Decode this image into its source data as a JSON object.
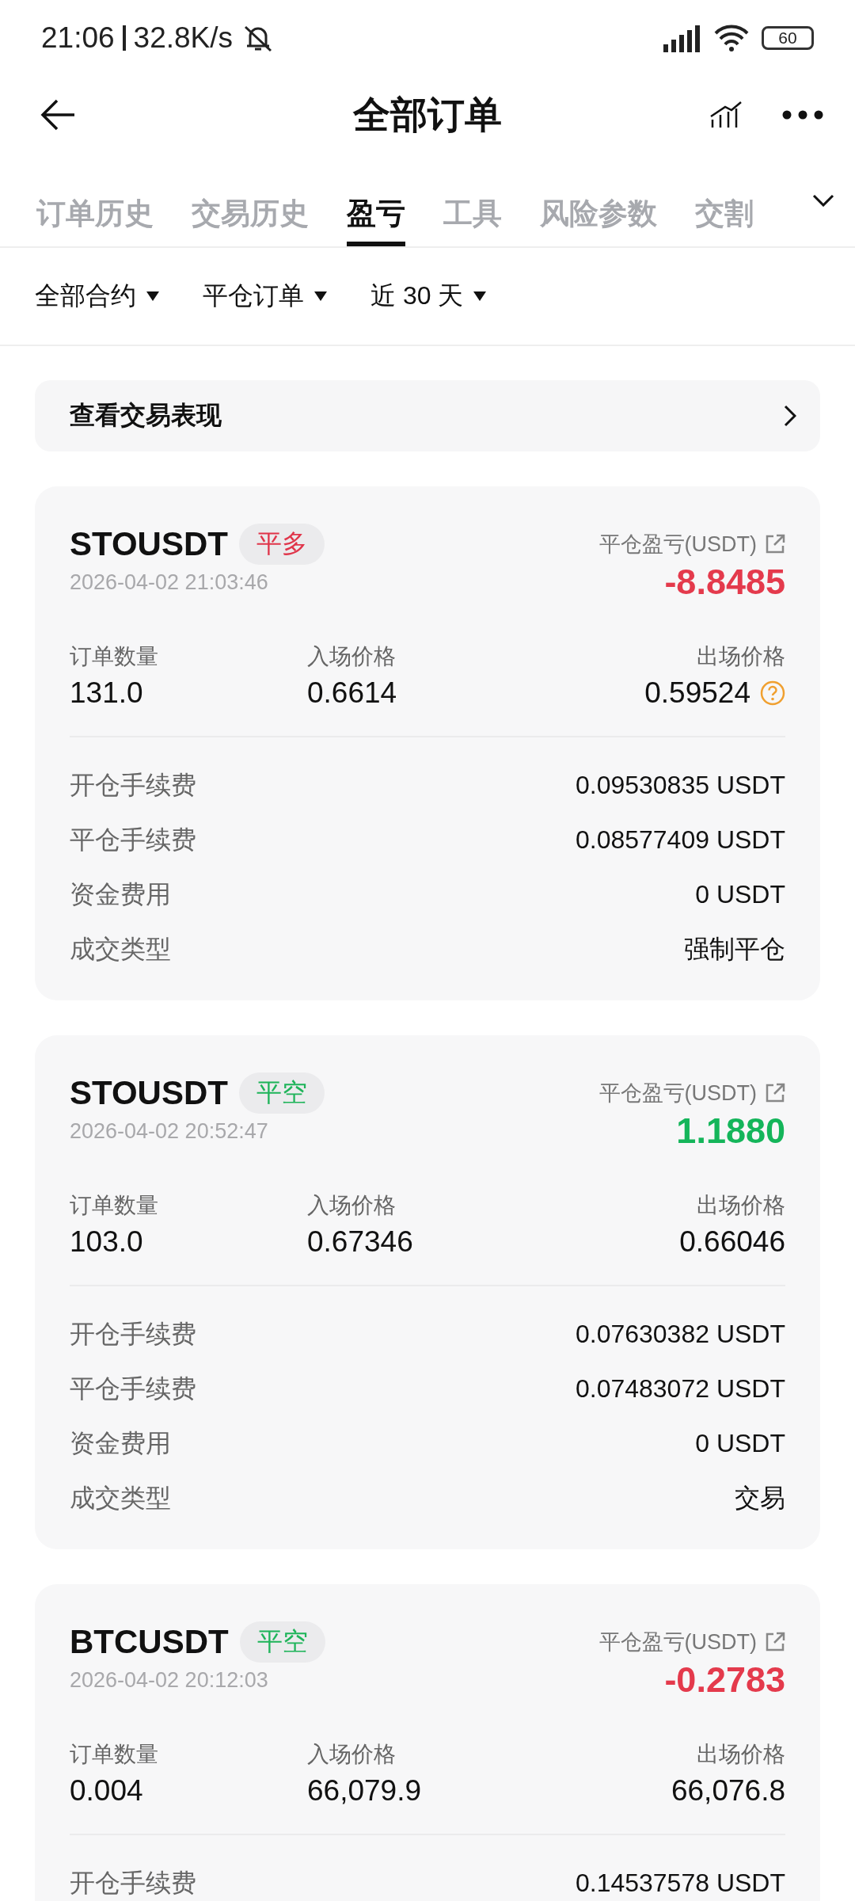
{
  "status_bar": {
    "time": "21:06",
    "speed": "32.8K/s",
    "battery": "60"
  },
  "header": {
    "title": "全部订单"
  },
  "tabs": [
    {
      "label": "订单历史",
      "selected": false
    },
    {
      "label": "交易历史",
      "selected": false
    },
    {
      "label": "盈亏",
      "selected": true
    },
    {
      "label": "工具",
      "selected": false
    },
    {
      "label": "风险参数",
      "selected": false
    },
    {
      "label": "交割",
      "selected": false
    }
  ],
  "filters": [
    "全部合约",
    "平仓订单",
    "近 30 天"
  ],
  "performance_link": {
    "label": "查看交易表现"
  },
  "orders": [
    {
      "symbol": "STOUSDT",
      "tag": {
        "label": "平多",
        "color": "#e0354a"
      },
      "time": "2026-04-02 21:03:46",
      "pnl_label": "平仓盈亏(USDT)",
      "pnl": {
        "value": "-8.8485",
        "color": "#e43a4c"
      },
      "fields": [
        {
          "label": "订单数量",
          "value": "131.0"
        },
        {
          "label": "入场价格",
          "value": "0.6614"
        },
        {
          "label": "出场价格",
          "value": "0.59524",
          "help": true
        }
      ],
      "fees": [
        {
          "label": "开仓手续费",
          "value": "0.09530835 USDT"
        },
        {
          "label": "平仓手续费",
          "value": "0.08577409 USDT"
        },
        {
          "label": "资金费用",
          "value": "0 USDT"
        },
        {
          "label": "成交类型",
          "value": "强制平仓"
        }
      ]
    },
    {
      "symbol": "STOUSDT",
      "tag": {
        "label": "平空",
        "color": "#1fb45a"
      },
      "time": "2026-04-02 20:52:47",
      "pnl_label": "平仓盈亏(USDT)",
      "pnl": {
        "value": "1.1880",
        "color": "#14b55a"
      },
      "fields": [
        {
          "label": "订单数量",
          "value": "103.0"
        },
        {
          "label": "入场价格",
          "value": "0.67346"
        },
        {
          "label": "出场价格",
          "value": "0.66046",
          "help": false
        }
      ],
      "fees": [
        {
          "label": "开仓手续费",
          "value": "0.07630382 USDT"
        },
        {
          "label": "平仓手续费",
          "value": "0.07483072 USDT"
        },
        {
          "label": "资金费用",
          "value": "0 USDT"
        },
        {
          "label": "成交类型",
          "value": "交易"
        }
      ]
    },
    {
      "symbol": "BTCUSDT",
      "tag": {
        "label": "平空",
        "color": "#1fb45a"
      },
      "time": "2026-04-02 20:12:03",
      "pnl_label": "平仓盈亏(USDT)",
      "pnl": {
        "value": "-0.2783",
        "color": "#e43a4c"
      },
      "fields": [
        {
          "label": "订单数量",
          "value": "0.004"
        },
        {
          "label": "入场价格",
          "value": "66,079.9"
        },
        {
          "label": "出场价格",
          "value": "66,076.8",
          "help": false
        }
      ],
      "fees": [
        {
          "label": "开仓手续费",
          "value": "0.14537578 USDT"
        }
      ]
    }
  ]
}
